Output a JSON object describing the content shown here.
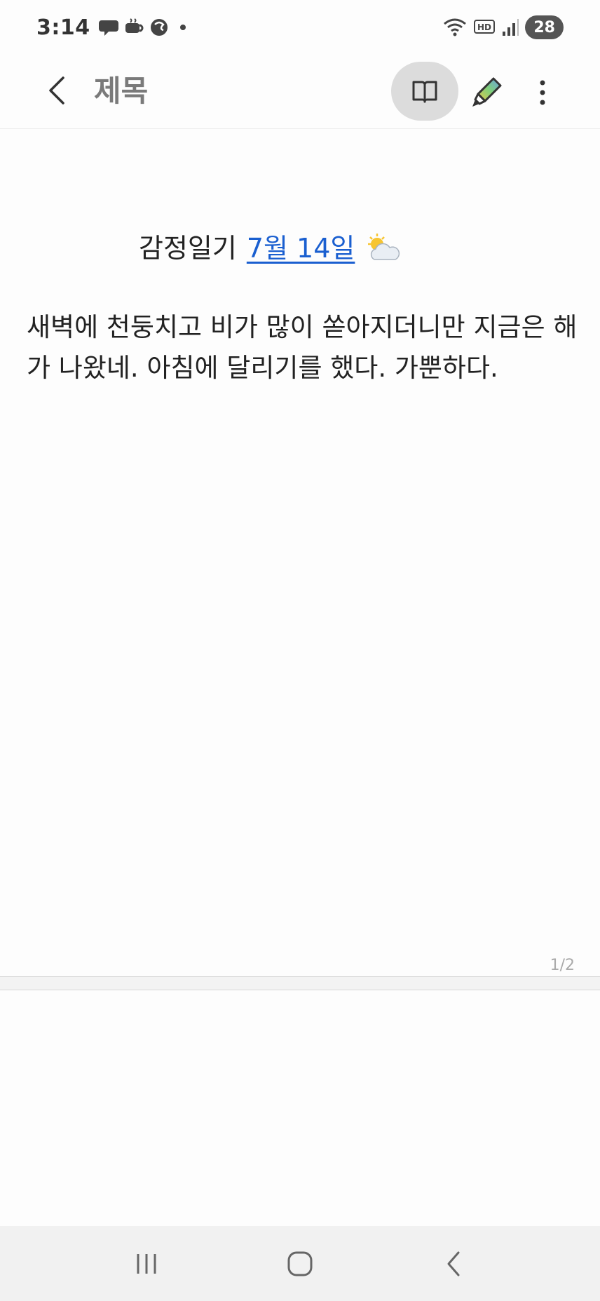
{
  "status_bar": {
    "time": "3:14",
    "left_icons": [
      "chat-bubble-icon",
      "coffee-icon",
      "swirl-icon",
      "dot-icon"
    ],
    "right_icons": [
      "wifi-icon",
      "hd-voice-icon",
      "signal-icon"
    ],
    "battery": "28"
  },
  "app_bar": {
    "title": "제목",
    "actions": [
      "back-icon",
      "reading-mode-icon",
      "pen-icon",
      "more-vert-icon"
    ]
  },
  "note": {
    "title_text": "감정일기",
    "date_link": "7월 14일",
    "weather": "sun-behind-cloud-icon",
    "body": "새벽에 천둥치고 비가 많이 쏟아지더니만 지금은 해가 나왔네. 아침에 달리기를 했다. 가뿐하다.",
    "page_indicator": "1/2"
  },
  "nav_bar": {
    "buttons": [
      "recents-icon",
      "home-icon",
      "back-nav-icon"
    ]
  },
  "colors": {
    "link": "#1a5fd0",
    "reading_btn_bg": "#dcdcdc",
    "nav_bg": "#f1f1f1"
  }
}
